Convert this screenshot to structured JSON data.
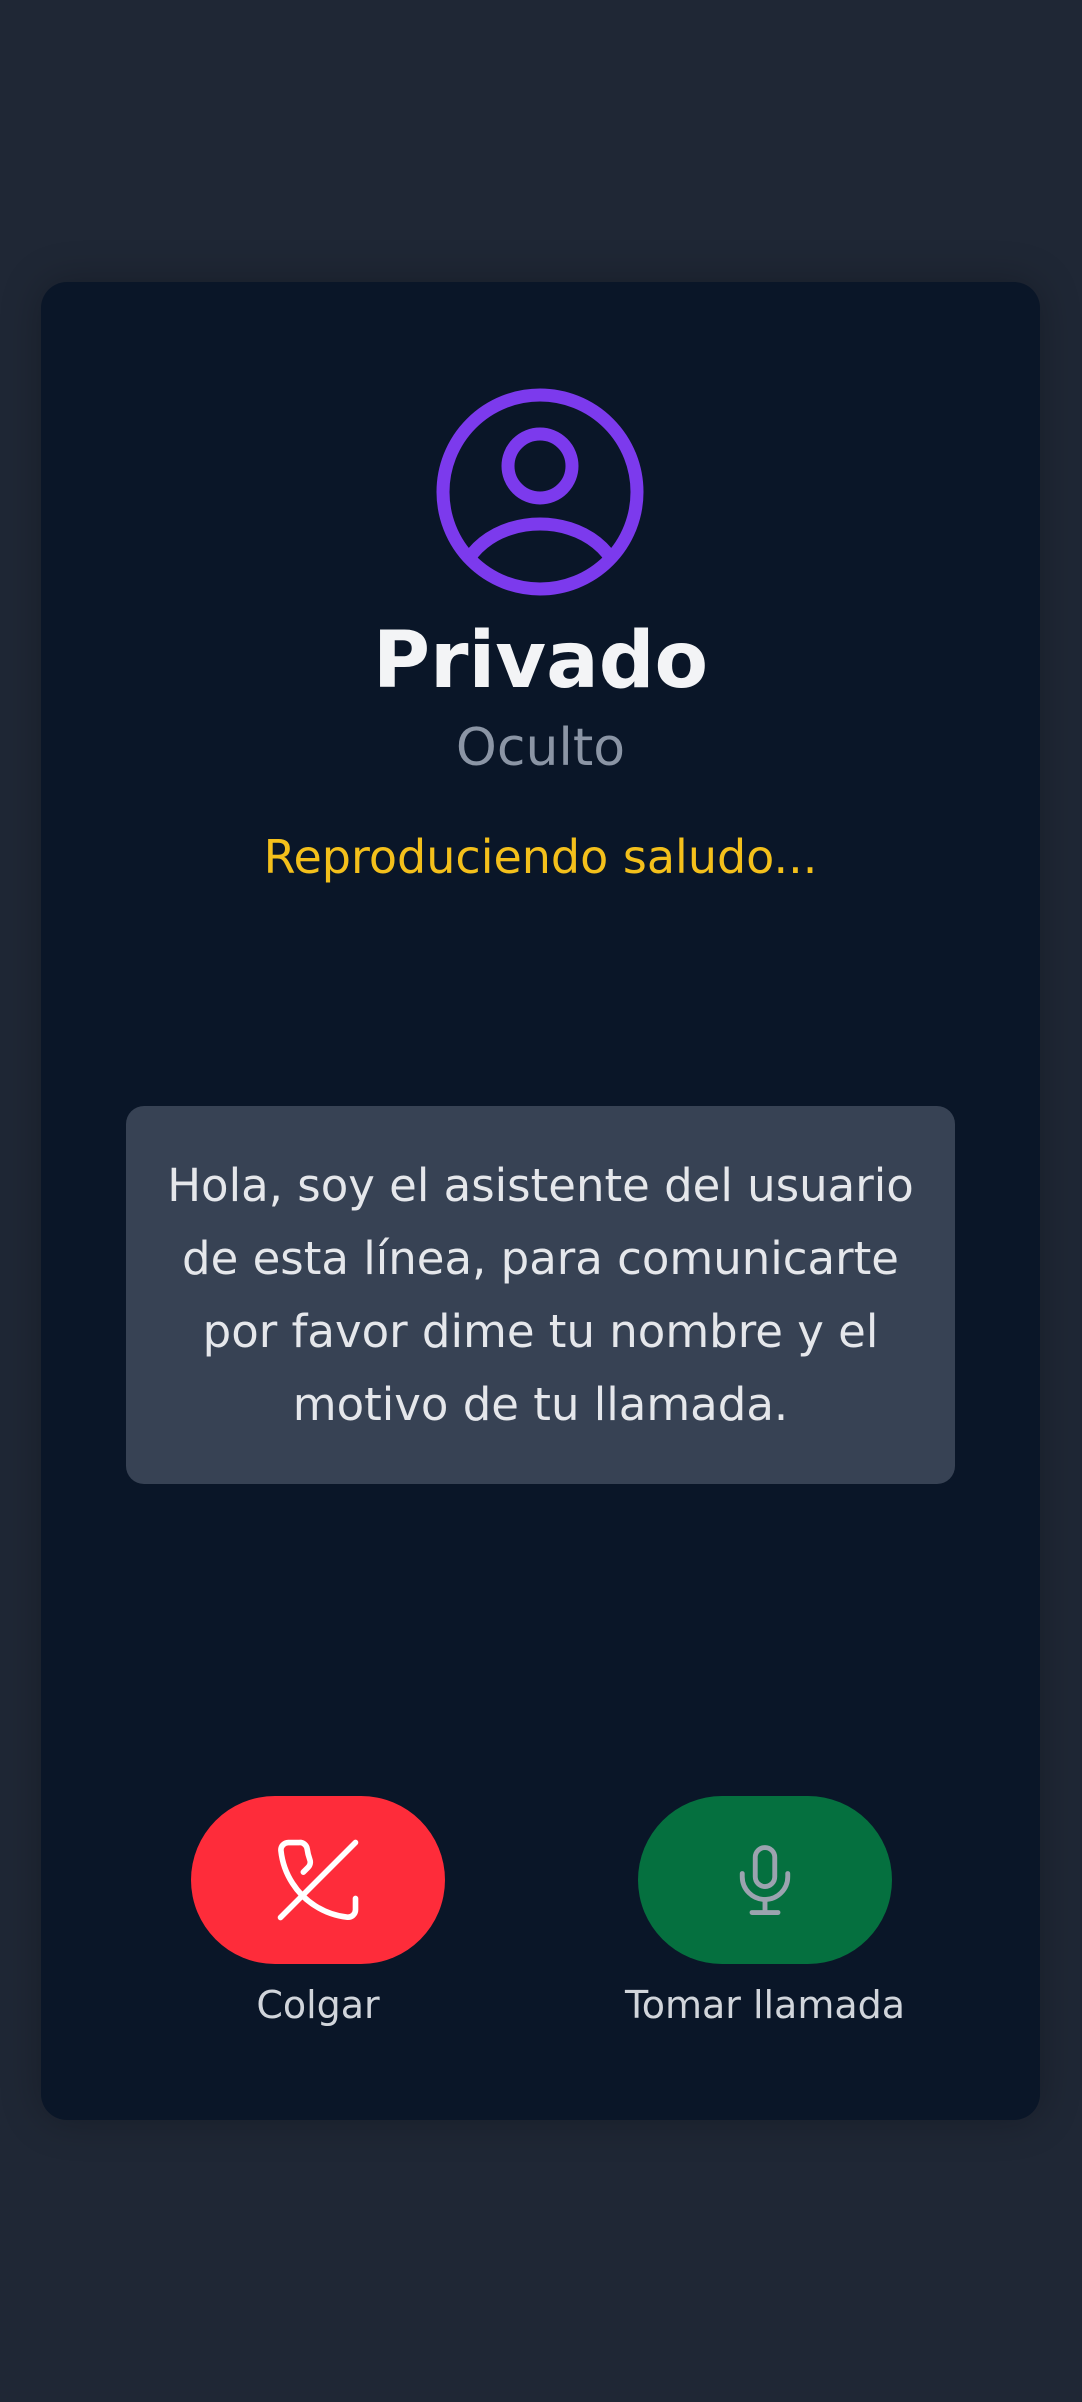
{
  "caller": {
    "name": "Privado",
    "number": "Oculto",
    "status": "Reproduciendo saludo..."
  },
  "transcript": {
    "text": "Hola, soy el asistente del usuario de esta línea, para comunicarte por favor dime tu nombre y el motivo de tu llamada."
  },
  "actions": {
    "hangup": {
      "label": "Colgar",
      "icon": "phone-hangup-icon"
    },
    "take_call": {
      "label": "Tomar llamada",
      "icon": "microphone-icon"
    }
  },
  "colors": {
    "background": "#1f2735",
    "card": "#0a1628",
    "avatar_accent": "#7c3aed",
    "status": "#f4c01b",
    "hangup": "#fe2c3a",
    "take_call": "#05703f",
    "transcript_bg": "#374254"
  }
}
